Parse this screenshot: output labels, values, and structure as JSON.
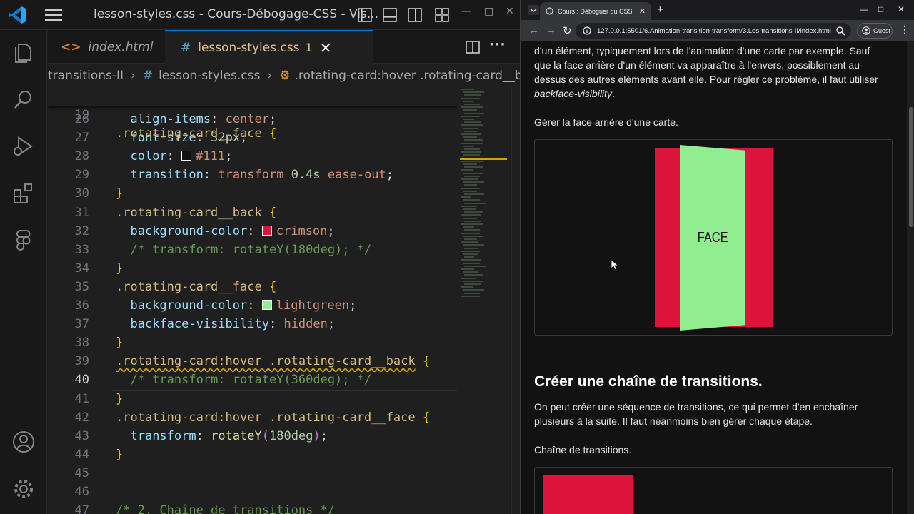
{
  "vscode": {
    "window_title": "lesson-styles.css - Cours-Débogage-CSS - Vis...",
    "tabs": [
      {
        "label": "index.html",
        "glyph": "<>"
      },
      {
        "label": "lesson-styles.css",
        "glyph": "#",
        "modified": "1"
      }
    ],
    "breadcrumbs": {
      "folder": "transitions-II",
      "file": "lesson-styles.css",
      "symbol": ".rotating-card:hover .rotating-card__back"
    },
    "sticky": {
      "line": "19",
      "selector": ".rotating-card__face",
      "brace": "{"
    },
    "lines": [
      {
        "n": "26",
        "prop": "align-items",
        "val": "center"
      },
      {
        "n": "27",
        "prop": "font-size",
        "num": "32px"
      },
      {
        "n": "28",
        "prop": "color",
        "val": "#111",
        "swatch": "#111111"
      },
      {
        "n": "29",
        "prop": "transition",
        "val": "transform ",
        "num": "0.4s",
        "val2": " ease-out"
      },
      {
        "n": "30"
      },
      {
        "n": "31",
        "selector": ".rotating-card__back"
      },
      {
        "n": "32",
        "prop": "background-color",
        "val": "crimson",
        "swatch": "#dc143c"
      },
      {
        "n": "33",
        "comment": "/* transform: rotateY(180deg); */"
      },
      {
        "n": "34"
      },
      {
        "n": "35",
        "selector": ".rotating-card__face"
      },
      {
        "n": "36",
        "prop": "background-color",
        "val": "lightgreen",
        "swatch": "#90ee90"
      },
      {
        "n": "37",
        "prop": "backface-visibility",
        "val": "hidden"
      },
      {
        "n": "38"
      },
      {
        "n": "39",
        "selector": ".rotating-card:hover .rotating-card__back"
      },
      {
        "n": "40",
        "comment": "/* transform: rotateY(360deg); */"
      },
      {
        "n": "41"
      },
      {
        "n": "42",
        "selector": ".rotating-card:hover .rotating-card__face"
      },
      {
        "n": "43",
        "prop": "transform",
        "fn": "rotateY",
        "num": "180deg"
      },
      {
        "n": "44"
      },
      {
        "n": "45"
      },
      {
        "n": "46"
      },
      {
        "n": "47",
        "comment": "/* 2. Chaîne de transitions */"
      }
    ],
    "colon": ":",
    "semicolon": ";",
    "open_brace": "{",
    "close_brace": "}",
    "paren_open": "(",
    "paren_close": ")"
  },
  "browser": {
    "tab_title": "Cours : Déboguer du CSS",
    "url": "127.0.0.1:5501/6.Animation-transition-transform/3.Les-transitions-II/index.html",
    "profile": "Guest",
    "para1_line1": "d'un élément, typiquement lors de l'animation d'une carte par exemple. Sauf",
    "para1_line2": "que la face arrière d'un élément va apparaître à l'envers, possiblement au-",
    "para1_line3": "dessus des autres éléments avant elle. Pour régler ce problème, il faut utiliser",
    "para1_em": "backface-visibility",
    "para1_end": ".",
    "demo1_caption": "Gérer la face arrière d'une carte.",
    "card_text": "FACE",
    "section_title": "Créer une chaîne de transitions.",
    "para2": "On peut créer une séquence de transitions, ce qui permet d'en enchaîner plusieurs à la suite. Il faut néanmoins bien gérer chaque étape.",
    "demo2_caption": "Chaîne de transitions."
  },
  "colors": {
    "crimson": "#dc143c",
    "lightgreen": "#90ee90",
    "accent": "#0078d4"
  }
}
